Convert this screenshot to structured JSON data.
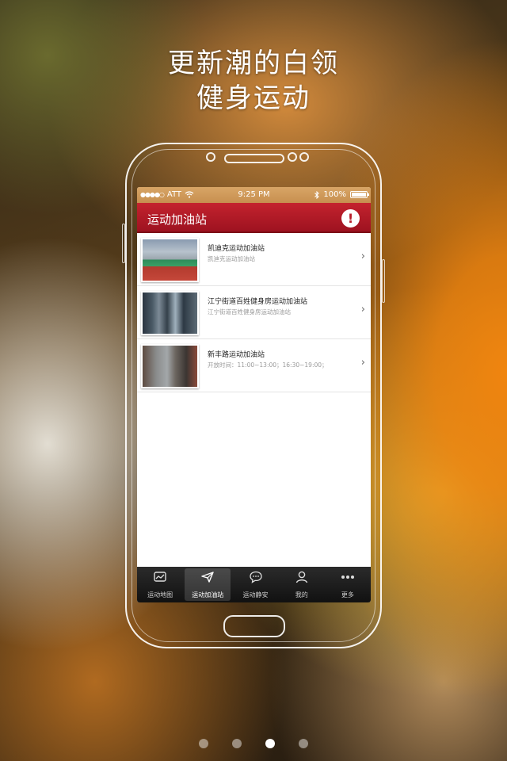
{
  "headline": {
    "line1": "更新潮的白领",
    "line2": "健身运动"
  },
  "status_bar": {
    "signal": "●●●●○",
    "carrier": "ATT",
    "time": "9:25 PM",
    "battery": "100%"
  },
  "app": {
    "title": "运动加油站",
    "header_color": "#b71b27",
    "alert_label": "!"
  },
  "stations": [
    {
      "name": "凯迪克运动加油站",
      "desc": "凯迪克运动加油站",
      "thumb_icon": "badminton-court-photo"
    },
    {
      "name": "江宁街道百姓健身房运动加油站",
      "desc": "江宁街道百姓健身房运动加油站",
      "thumb_icon": "gym-photo"
    },
    {
      "name": "新丰路运动加油站",
      "desc": "开放时间：11:00~13:00；16:30~19:00；",
      "thumb_icon": "fitness-room-photo"
    }
  ],
  "tabs": [
    {
      "label": "运动地图",
      "icon": "map-chart-icon",
      "active": false
    },
    {
      "label": "运动加油站",
      "icon": "paper-plane-icon",
      "active": true
    },
    {
      "label": "运动静安",
      "icon": "chat-bubble-icon",
      "active": false
    },
    {
      "label": "我的",
      "icon": "person-icon",
      "active": false
    },
    {
      "label": "更多",
      "icon": "more-dots-icon",
      "active": false
    }
  ],
  "pager": {
    "count": 4,
    "active_index": 2
  }
}
